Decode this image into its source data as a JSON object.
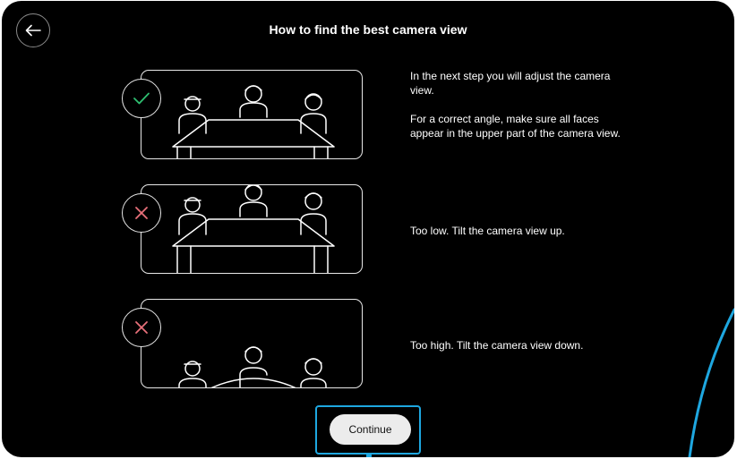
{
  "header": {
    "title": "How to find the best camera view",
    "back_icon": "arrow-left-icon"
  },
  "steps": [
    {
      "status": "correct",
      "status_icon": "checkmark-icon",
      "status_color": "#2fbf71",
      "paragraphs": [
        "In the next step you will adjust the camera view.",
        "For a correct angle, make sure all faces appear in the upper part of the camera view."
      ]
    },
    {
      "status": "incorrect",
      "status_icon": "cross-icon",
      "status_color": "#e8707a",
      "paragraphs": [
        "Too low. Tilt the camera view up."
      ]
    },
    {
      "status": "incorrect",
      "status_icon": "cross-icon",
      "status_color": "#e8707a",
      "paragraphs": [
        "Too high. Tilt the camera view down."
      ]
    }
  ],
  "footer": {
    "continue_label": "Continue",
    "highlight_color": "#1ea7e0"
  }
}
